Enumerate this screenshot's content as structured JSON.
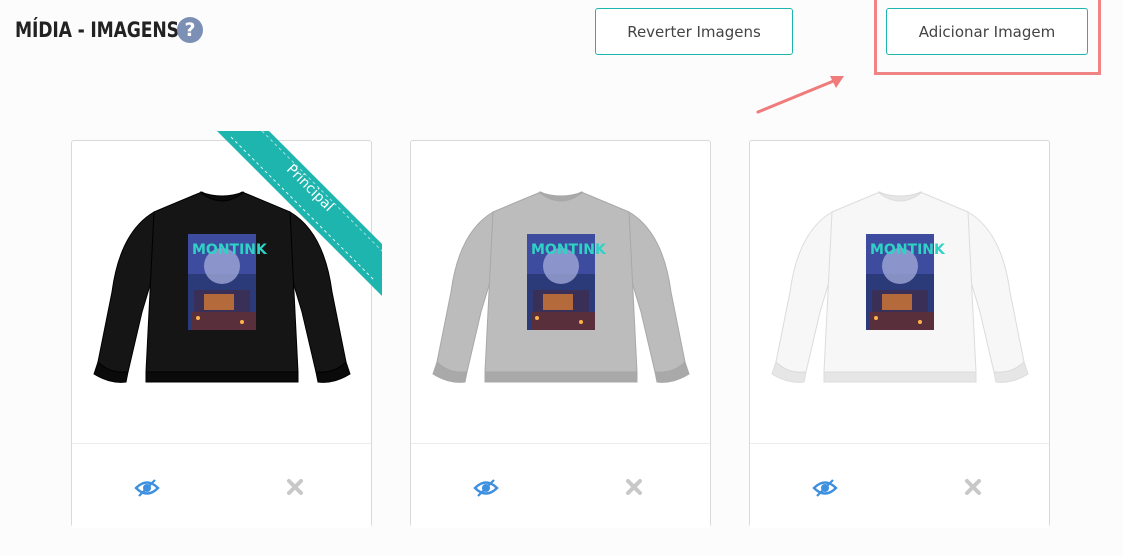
{
  "header": {
    "title": "MÍDIA - IMAGENS",
    "help_icon": "question-circle-icon"
  },
  "toolbar": {
    "revert_label": "Reverter Imagens",
    "add_label": "Adicionar Imagem"
  },
  "annotation": {
    "highlight_color": "#f08484",
    "arrow_icon": "arrow-pointer-icon"
  },
  "images": [
    {
      "color_name": "black",
      "shirt_color": "#151515",
      "cuff_color": "#0a0a0a",
      "principal": true,
      "ribbon_label": "Principal"
    },
    {
      "color_name": "gray",
      "shirt_color": "#bcbcbc",
      "cuff_color": "#a9a9a9",
      "principal": false
    },
    {
      "color_name": "white",
      "shirt_color": "#f7f7f7",
      "cuff_color": "#e6e6e6",
      "principal": false
    }
  ],
  "print_text": "MONTINK",
  "colors": {
    "accent": "#1eb5ae",
    "eye_icon": "#3d8fe0",
    "remove_icon": "#c8c8c8"
  }
}
